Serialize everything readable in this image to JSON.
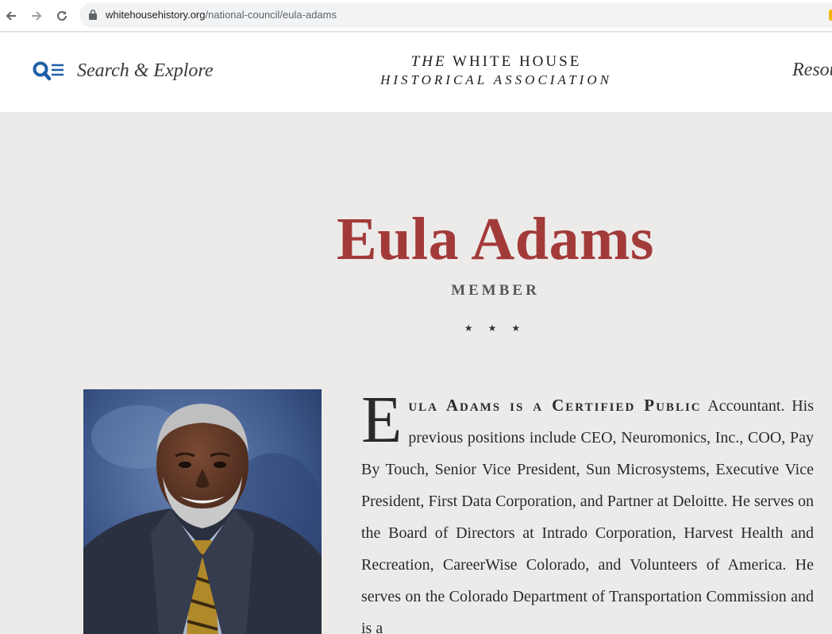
{
  "browser": {
    "url_domain": "whitehousehistory.org",
    "url_path": "/national-council/eula-adams"
  },
  "header": {
    "search_label": "Search & Explore",
    "logo_the": "THE",
    "logo_line1": "WHITE HOUSE",
    "logo_line2": "HISTORICAL ASSOCIATION",
    "resources_label": "Resou"
  },
  "profile": {
    "name": "Eula Adams",
    "role": "MEMBER",
    "divider": "★ ★ ★",
    "bio_dropcap": "E",
    "bio_lead": "ula Adams is a Certified Public",
    "bio_text": "Accountant. His previous positions include CEO, Neuromonics, Inc., COO, Pay By Touch, Senior Vice President, Sun Microsystems, Executive Vice President, First Data Corporation, and Partner at Deloitte. He serves on the Board of Directors at Intrado Corporation, Harvest Health and Recreation, CareerWise Colorado, and Volunteers of America. He serves on the Colorado Department of Transportation Commission and is a"
  },
  "colors": {
    "name_red": "#a33a3a",
    "icon_blue": "#1f5fa8",
    "page_bg": "#ecebe9"
  }
}
